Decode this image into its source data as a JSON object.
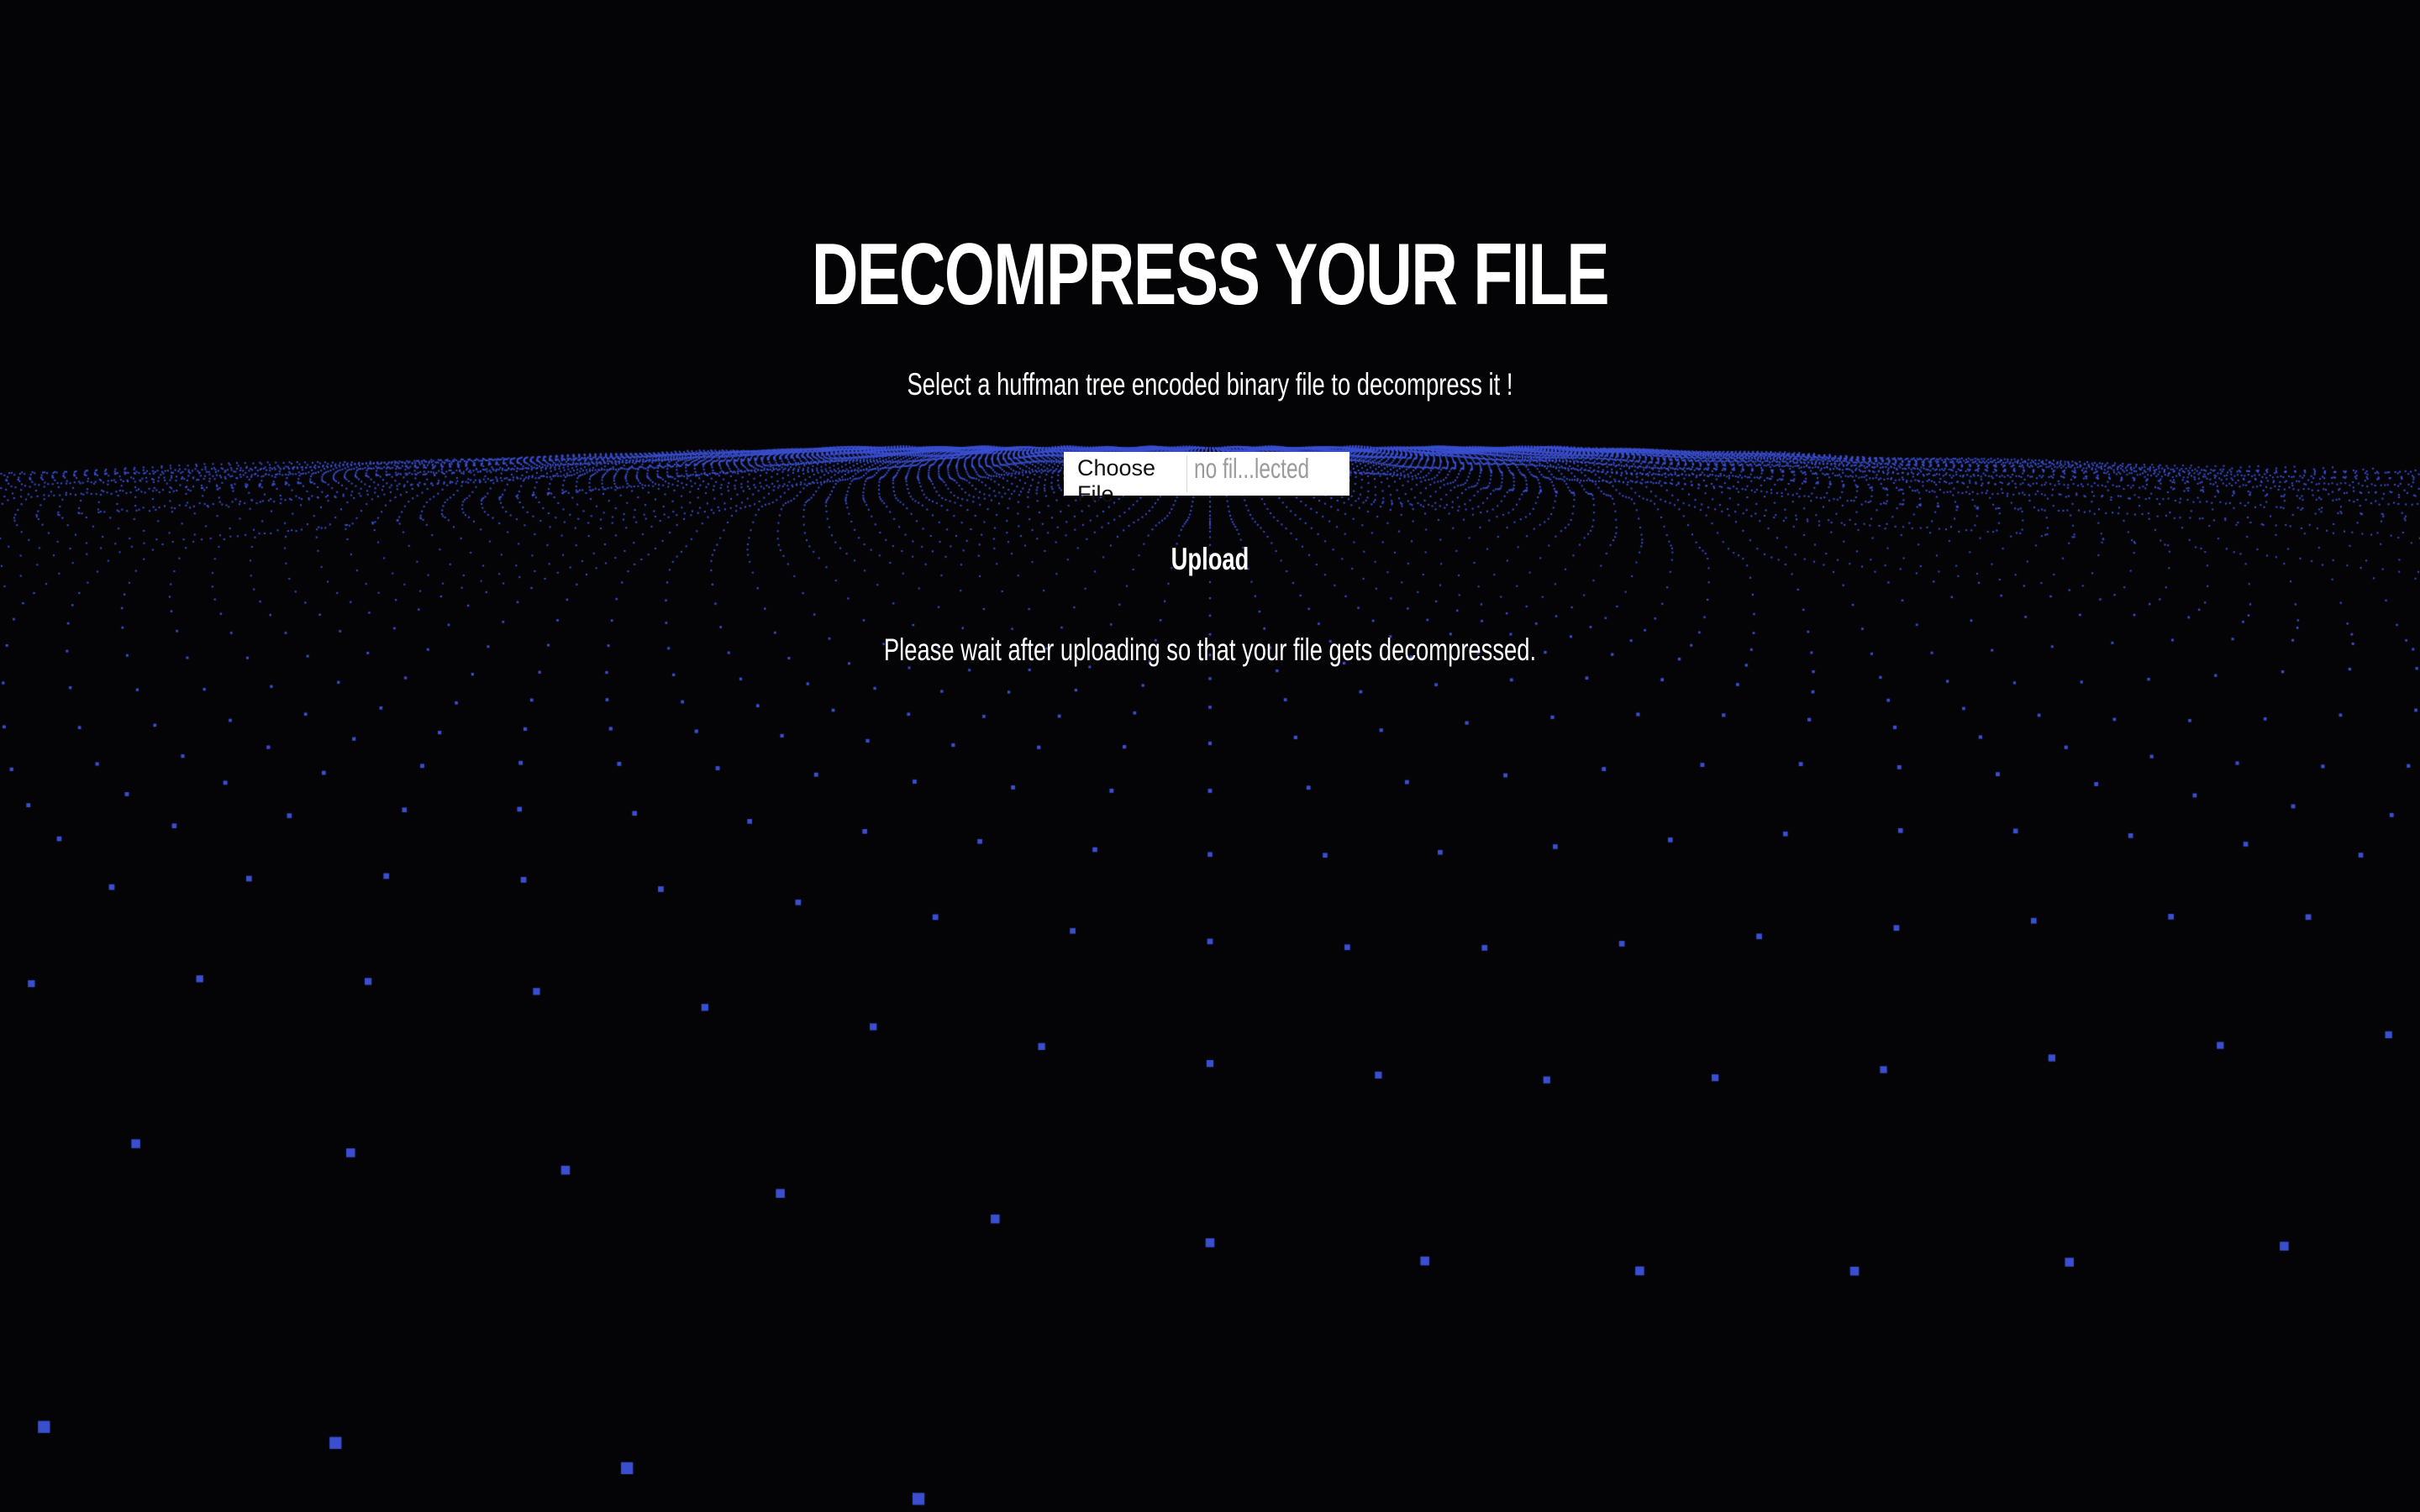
{
  "page": {
    "title": "DECOMPRESS YOUR FILE",
    "subtitle": "Select a huffman tree encoded binary file to decompress it !",
    "wait_message": "Please wait after uploading so that your file gets decompressed."
  },
  "file_input": {
    "button_label": "Choose File",
    "status_text": "no fil...lected"
  },
  "upload": {
    "label": "Upload"
  },
  "background": {
    "color": "#040407",
    "particle_color": "#3a4fd0",
    "effect": "perspective-particle-grid"
  }
}
